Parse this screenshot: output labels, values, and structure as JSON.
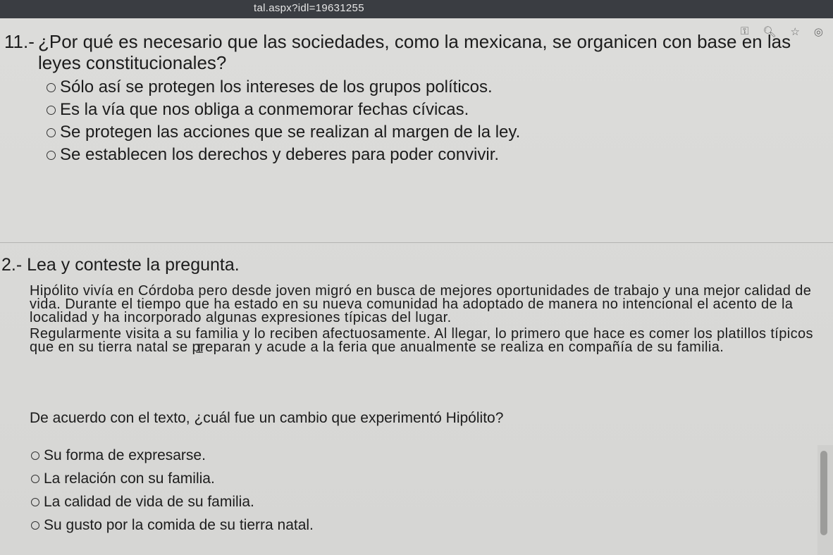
{
  "browser": {
    "url_fragment": "tal.aspx?idl=19631255"
  },
  "toolbar_icons": [
    "key-icon",
    "zoom-icon",
    "star-icon",
    "profile-icon"
  ],
  "q1": {
    "number": "11.-",
    "text": "¿Por qué es necesario que las sociedades, como la mexicana, se organicen con base en las leyes constitucionales?",
    "options": [
      "Sólo así se protegen los intereses de los grupos políticos.",
      "Es la vía que nos obliga a conmemorar fechas cívicas.",
      "Se protegen las acciones que se realizan al margen de la ley.",
      "Se establecen los derechos y deberes para poder convivir."
    ]
  },
  "q2": {
    "heading": "2.- Lea y conteste la pregunta.",
    "passage": [
      "Hipólito vivía en Córdoba pero desde joven migró en busca de mejores oportunidades de trabajo y una mejor calidad de vida. Durante el tiempo que ha estado en su nueva comunidad ha adoptado de manera no intencional el acento de la localidad y ha incorporado algunas expresiones típicas del lugar.",
      "Regularmente visita a su familia y lo reciben afectuosamente. Al llegar, lo primero que hace es comer los platillos típicos que en su tierra natal se preparan y acude a la feria que anualmente se realiza en compañía de su familia."
    ],
    "question": "De acuerdo con el texto, ¿cuál fue un cambio que experimentó Hipólito?",
    "options": [
      "Su forma de expresarse.",
      "La relación con su familia.",
      "La calidad de vida de su familia.",
      "Su gusto por la comida de su tierra natal."
    ]
  }
}
